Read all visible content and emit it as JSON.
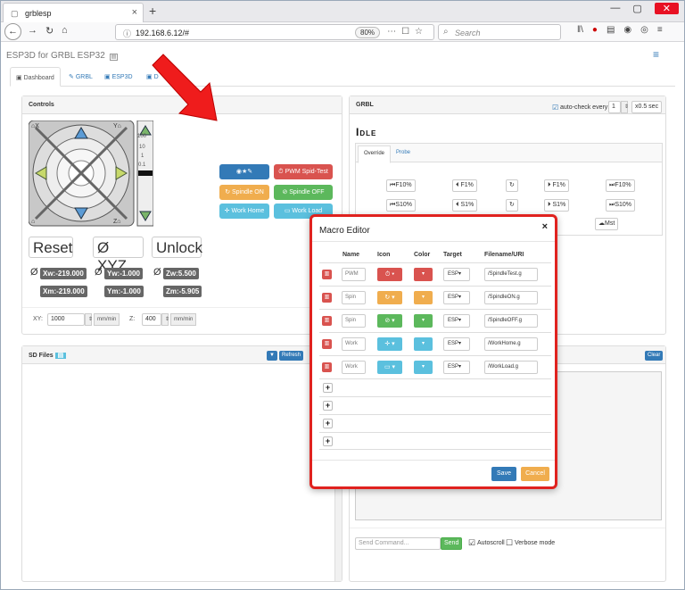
{
  "browser": {
    "tab_title": "grblesp",
    "url": "192.168.6.12/#",
    "zoom": "80%",
    "search_placeholder": "Search"
  },
  "app": {
    "brand": "ESP3D for GRBL ESP32",
    "tabs": [
      "Dashboard",
      "GRBL",
      "ESP3D",
      "D"
    ]
  },
  "controls": {
    "title": "Controls",
    "jog_labels": {
      "x_home": "X",
      "y_home": "Y",
      "z_home": "Z",
      "steps": [
        "100",
        "10",
        "1",
        "0.1"
      ]
    },
    "buttons": {
      "reset": "Reset",
      "xyz": "Ø XYZ",
      "unlock": "Unlock"
    },
    "positions": {
      "xw": "Xw:-219.000",
      "yw": "Yw:-1.000",
      "zw": "Zw:5.500",
      "xm": "Xm:-219.000",
      "ym": "Ym:-1.000",
      "zm": "Zm:-5.905",
      "zero_symbol": "Ø"
    },
    "macros": [
      {
        "label": "",
        "color": "#337ab7"
      },
      {
        "label": "PWM Spid-Test",
        "color": "#d9534f"
      },
      {
        "label": "Spindle ON",
        "color": "#f0ad4e"
      },
      {
        "label": "Spindle OFF",
        "color": "#5cb85c"
      },
      {
        "label": "Work Home",
        "color": "#5bc0de"
      },
      {
        "label": "Work Load",
        "color": "#5bc0de"
      }
    ],
    "feed": {
      "xy_label": "XY:",
      "xy_value": "1000",
      "xy_unit": "mm/min",
      "z_label": "Z:",
      "z_value": "400",
      "z_unit": "mm/min"
    }
  },
  "grbl": {
    "title": "GRBL",
    "autocheck_label": "auto-check every:",
    "autocheck_value": "1",
    "autocheck_unit": "x0.5 sec",
    "state": "Idle",
    "tabs": [
      "Override",
      "Probe"
    ],
    "override_buttons": [
      "F10%",
      "F1%",
      "F1%",
      "F10%",
      "S10%",
      "S1%",
      "S1%",
      "S10%"
    ],
    "mist_label": "Mst"
  },
  "sd": {
    "title": "SD Files",
    "refresh": "Refresh"
  },
  "terminal": {
    "clear": "Clear",
    "command_placeholder": "Send Command...",
    "send": "Send",
    "autoscroll": "Autoscroll",
    "verbose": "Verbose mode"
  },
  "modal": {
    "title": "Macro Editor",
    "close": "×",
    "headers": [
      "Name",
      "Icon",
      "Color",
      "Target",
      "Filename/URI"
    ],
    "rows": [
      {
        "name": "PWM",
        "icon_color": "#d9534f",
        "color": "#d9534f",
        "target": "ESP▾",
        "file": "/SpindleTest.g"
      },
      {
        "name": "Spin",
        "icon_color": "#f0ad4e",
        "color": "#f0ad4e",
        "target": "ESP▾",
        "file": "/SpindleON.g"
      },
      {
        "name": "Spin",
        "icon_color": "#5cb85c",
        "color": "#5cb85c",
        "target": "ESP▾",
        "file": "/SpindleOFF.g"
      },
      {
        "name": "Work",
        "icon_color": "#5bc0de",
        "color": "#5bc0de",
        "target": "ESP▾",
        "file": "/WorkHome.g"
      },
      {
        "name": "Work",
        "icon_color": "#5bc0de",
        "color": "#5bc0de",
        "target": "ESP▾",
        "file": "/WorkLoad.g"
      }
    ],
    "save": "Save",
    "cancel": "Cancel"
  }
}
